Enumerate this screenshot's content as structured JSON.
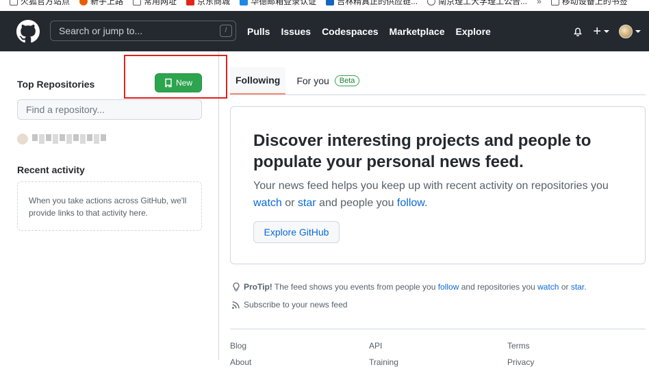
{
  "bookmarks": [
    {
      "label": "火狐官方站点",
      "color": "#ffffff",
      "icon": "folder-icon"
    },
    {
      "label": "新手上路",
      "color": "#e66000",
      "icon": "firefox-icon"
    },
    {
      "label": "常用网址",
      "color": "#ffffff",
      "icon": "folder-icon"
    },
    {
      "label": "京东商城",
      "color": "#e1251b",
      "icon": "jd-icon"
    },
    {
      "label": "华德邮箱登录认证",
      "color": "#1e88e5",
      "icon": "mail-icon"
    },
    {
      "label": "吉林精真正的供应链...",
      "color": "#1565c0",
      "icon": "xd-icon"
    },
    {
      "label": "南京理工大学理工公告...",
      "color": "#ffffff",
      "icon": "globe-icon"
    },
    {
      "label": "移动设备上的书签",
      "color": "#ffffff",
      "icon": "folder-icon"
    }
  ],
  "header": {
    "search_placeholder": "Search or jump to...",
    "slash_hint": "/",
    "nav": [
      "Pulls",
      "Issues",
      "Codespaces",
      "Marketplace",
      "Explore"
    ]
  },
  "sidebar": {
    "top_repos_title": "Top Repositories",
    "new_button": "New",
    "find_placeholder": "Find a repository...",
    "recent_activity_title": "Recent activity",
    "recent_activity_text": "When you take actions across GitHub, we'll provide links to that activity here."
  },
  "feed": {
    "tab_following": "Following",
    "tab_for_you": "For you",
    "beta_label": "Beta",
    "card_heading": "Discover interesting projects and people to populate your personal news feed.",
    "card_text_1": "Your news feed helps you keep up with recent activity on repositories you",
    "card_link_watch": "watch",
    "card_text_or": " or ",
    "card_link_star": "star",
    "card_text_2": " and people you ",
    "card_link_follow": "follow",
    "card_text_end": ".",
    "explore_button": "Explore GitHub"
  },
  "protip": {
    "label": "ProTip!",
    "text_1": " The feed shows you events from people you ",
    "link_follow": "follow",
    "text_2": " and repositories you ",
    "link_watch": "watch",
    "text_or": " or ",
    "link_star": "star",
    "text_end": "."
  },
  "subscribe_text": "Subscribe to your news feed",
  "footer": {
    "col1": [
      "Blog",
      "About"
    ],
    "col2": [
      "API",
      "Training"
    ],
    "col3": [
      "Terms",
      "Privacy"
    ]
  },
  "colors": {
    "header_bg": "#24292f",
    "new_button": "#2da44e",
    "link": "#0969da",
    "highlight_box": "#e0201a"
  }
}
